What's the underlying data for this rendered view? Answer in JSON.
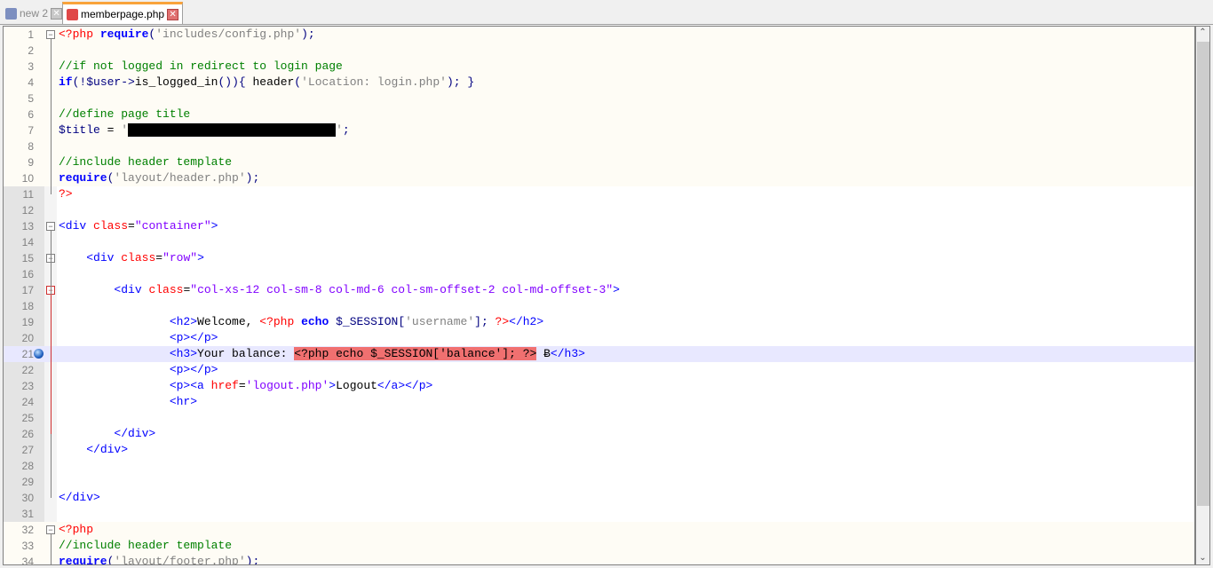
{
  "tabs": [
    {
      "label": "new 2",
      "active": false
    },
    {
      "label": "memberpage.php",
      "active": true
    }
  ],
  "current_line": 21,
  "lines": [
    [
      [
        "php",
        "<?php "
      ],
      [
        "kw",
        "require"
      ],
      [
        "op",
        "("
      ],
      [
        "str",
        "'includes/config.php'"
      ],
      [
        "op",
        ");"
      ]
    ],
    [],
    [
      [
        "com",
        "//if not logged in redirect to login page"
      ]
    ],
    [
      [
        "kw",
        "if"
      ],
      [
        "op",
        "(!"
      ],
      [
        "var",
        "$user"
      ],
      [
        "op",
        "->"
      ],
      [
        "pl",
        "is_logged_in"
      ],
      [
        "op",
        "()){ "
      ],
      [
        "pl",
        "header"
      ],
      [
        "op",
        "("
      ],
      [
        "str",
        "'Location: login.php'"
      ],
      [
        "op",
        "); }"
      ]
    ],
    [],
    [
      [
        "com",
        "//define page title"
      ]
    ],
    [
      [
        "var",
        "$title"
      ],
      [
        "pl",
        " = "
      ],
      [
        "str",
        "'"
      ],
      [
        "red",
        "                              "
      ],
      [
        "str",
        "'"
      ],
      [
        "op",
        ";"
      ]
    ],
    [],
    [
      [
        "com",
        "//include header template"
      ]
    ],
    [
      [
        "kw",
        "require"
      ],
      [
        "op",
        "("
      ],
      [
        "str",
        "'layout/header.php'"
      ],
      [
        "op",
        ");"
      ]
    ],
    [
      [
        "php",
        "?>"
      ]
    ],
    [],
    [
      [
        "tag",
        "<div "
      ],
      [
        "attr",
        "class"
      ],
      [
        "pl",
        "="
      ],
      [
        "val",
        "\"container\""
      ],
      [
        "tag",
        ">"
      ]
    ],
    [],
    [
      [
        "pl",
        "    "
      ],
      [
        "tag",
        "<div "
      ],
      [
        "attr",
        "class"
      ],
      [
        "pl",
        "="
      ],
      [
        "val",
        "\"row\""
      ],
      [
        "tag",
        ">"
      ]
    ],
    [],
    [
      [
        "pl",
        "        "
      ],
      [
        "tag",
        "<div "
      ],
      [
        "attr",
        "class"
      ],
      [
        "pl",
        "="
      ],
      [
        "val",
        "\"col-xs-12 col-sm-8 col-md-6 col-sm-offset-2 col-md-offset-3\""
      ],
      [
        "tag",
        ">"
      ]
    ],
    [],
    [
      [
        "pl",
        "                "
      ],
      [
        "tag",
        "<h2>"
      ],
      [
        "pl",
        "Welcome, "
      ],
      [
        "php",
        "<?php "
      ],
      [
        "kw",
        "echo "
      ],
      [
        "var",
        "$_SESSION"
      ],
      [
        "op",
        "["
      ],
      [
        "str",
        "'username'"
      ],
      [
        "op",
        "]; "
      ],
      [
        "php",
        "?>"
      ],
      [
        "tag",
        "</h2>"
      ]
    ],
    [
      [
        "pl",
        "                "
      ],
      [
        "tag",
        "<p></p>"
      ]
    ],
    [
      [
        "pl",
        "                "
      ],
      [
        "tag",
        "<h3>"
      ],
      [
        "pl",
        "Your balance: "
      ],
      [
        "hl",
        "<?php echo $_SESSION['balance']; ?>"
      ],
      [
        "pl",
        " Ƀ"
      ],
      [
        "tag",
        "</h3>"
      ]
    ],
    [
      [
        "pl",
        "                "
      ],
      [
        "tag",
        "<p></p>"
      ]
    ],
    [
      [
        "pl",
        "                "
      ],
      [
        "tag",
        "<p><a "
      ],
      [
        "attr",
        "href"
      ],
      [
        "pl",
        "="
      ],
      [
        "val",
        "'logout.php'"
      ],
      [
        "tag",
        ">"
      ],
      [
        "pl",
        "Logout"
      ],
      [
        "tag",
        "</a></p>"
      ]
    ],
    [
      [
        "pl",
        "                "
      ],
      [
        "tag",
        "<hr>"
      ]
    ],
    [],
    [
      [
        "pl",
        "        "
      ],
      [
        "tag",
        "</div>"
      ]
    ],
    [
      [
        "pl",
        "    "
      ],
      [
        "tag",
        "</div>"
      ]
    ],
    [],
    [],
    [
      [
        "tag",
        "</div>"
      ]
    ],
    [],
    [
      [
        "php",
        "<?php"
      ]
    ],
    [
      [
        "com",
        "//include header template"
      ]
    ],
    [
      [
        "kw",
        "require"
      ],
      [
        "op",
        "("
      ],
      [
        "str",
        "'layout/footer.php'"
      ],
      [
        "op",
        ");"
      ]
    ]
  ]
}
